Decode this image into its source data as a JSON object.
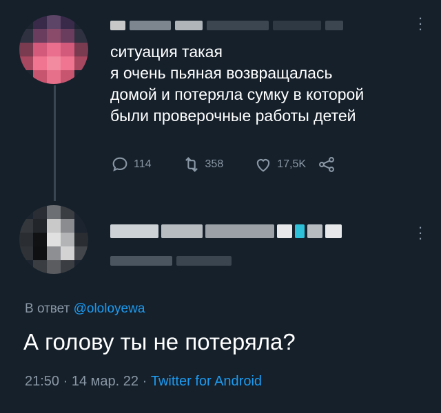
{
  "original_tweet": {
    "text_lines": [
      "ситуация такая",
      "я очень пьяная возвращалась",
      "домой и потеряла сумку в которой",
      "были проверочные работы детей"
    ],
    "actions": {
      "replies": "114",
      "retweets": "358",
      "likes": "17,5K"
    },
    "more_icon": "more-vertical-icon"
  },
  "reply_tweet": {
    "reply_prefix": "В ответ",
    "reply_handle": "@ololoyewa",
    "text": "А голову ты не потеряла?",
    "time": "21:50",
    "date": "14 мар. 22",
    "separator": "·",
    "client": "Twitter for Android",
    "more_icon": "more-vertical-icon"
  },
  "colors": {
    "background": "#15202b",
    "text_primary": "#ffffff",
    "text_secondary": "#8b98a5",
    "link": "#1d9bf0"
  }
}
